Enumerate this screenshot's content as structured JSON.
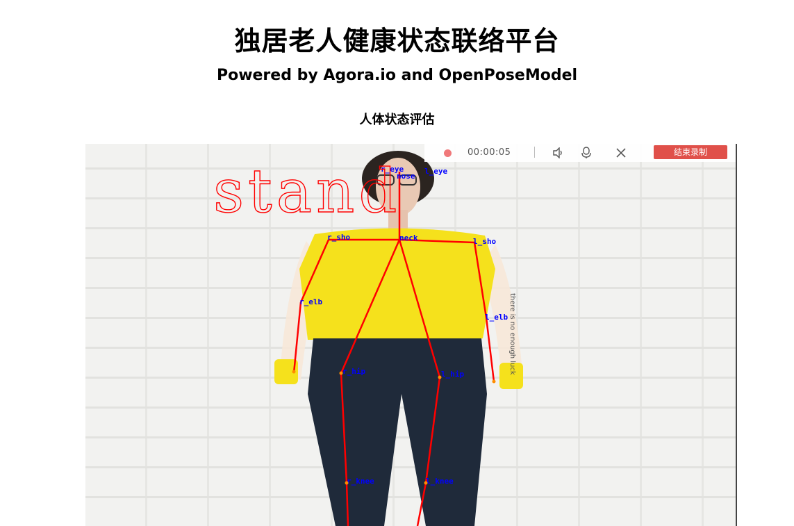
{
  "header": {
    "title": "独居老人健康状态联络平台",
    "subtitle": "Powered by Agora.io and OpenPoseModel",
    "section_title": "人体状态评估"
  },
  "video": {
    "pose_label": "stand",
    "keypoint_labels": {
      "r_eye": "r_eye",
      "l_eye": "l_eye",
      "nose": "nose",
      "r_sho": "r_sho",
      "neck": "neck",
      "l_sho": "l_sho",
      "r_elb": "r_elb",
      "l_elb": "l_elb",
      "r_hip": "r_hip",
      "l_hip": "l_hip",
      "r_knee": "r_knee",
      "l_knee": "l_knee"
    },
    "shirt_text": "there is no enough luck"
  },
  "recorder": {
    "time": "00:00:05",
    "stop_label": "结束录制",
    "volume_icon": "speaker-icon",
    "mic_icon": "microphone-icon",
    "close_icon": "close-icon"
  },
  "colors": {
    "skeleton": "#ff0000",
    "keypoint_label": "#0000ff",
    "shirt": "#f5e11c",
    "jeans": "#1f2a3a",
    "record_button": "#e0504a"
  }
}
